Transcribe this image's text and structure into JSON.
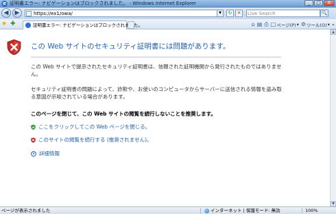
{
  "window": {
    "title": "証明書エラー: ナビゲーションはブロックされました。 - Windows Internet Explorer",
    "minimize": "_",
    "maximize": "□",
    "close": "X"
  },
  "address_bar": {
    "url": "https://ex1/owa/",
    "search_placeholder": "Live Search"
  },
  "tab": {
    "label": "証明書エラー: ナビゲーションはブロックされました。"
  },
  "command_bar": {
    "page_menu": "ページ(P)",
    "tools_menu": "ツール(O)"
  },
  "content": {
    "heading": "この Web サイトのセキュリティ証明書には問題があります。",
    "paragraph1": "この Web サイトで提示されたセキュリティ証明書は、信頼された証明機関から発行されたものではありません。",
    "paragraph2": "セキュリティ証明書の問題によって、詐欺や、お使いのコンピュータからサーバーに送信される情報を盗み取る意図が示唆されている場合があります。",
    "recommendation": "このページを閉じて、この Web サイトの閲覧を続行しないことを推奨します。",
    "close_link": "ここをクリックしてこの Web ページを閉じる。",
    "continue_link": "このサイトの閲覧を続行する (推奨されません)。",
    "more_info_link": "詳細情報"
  },
  "status_bar": {
    "text": "ページが表示されました",
    "zone": "インターネット | 保護モード: 無効",
    "zoom": "100%"
  }
}
